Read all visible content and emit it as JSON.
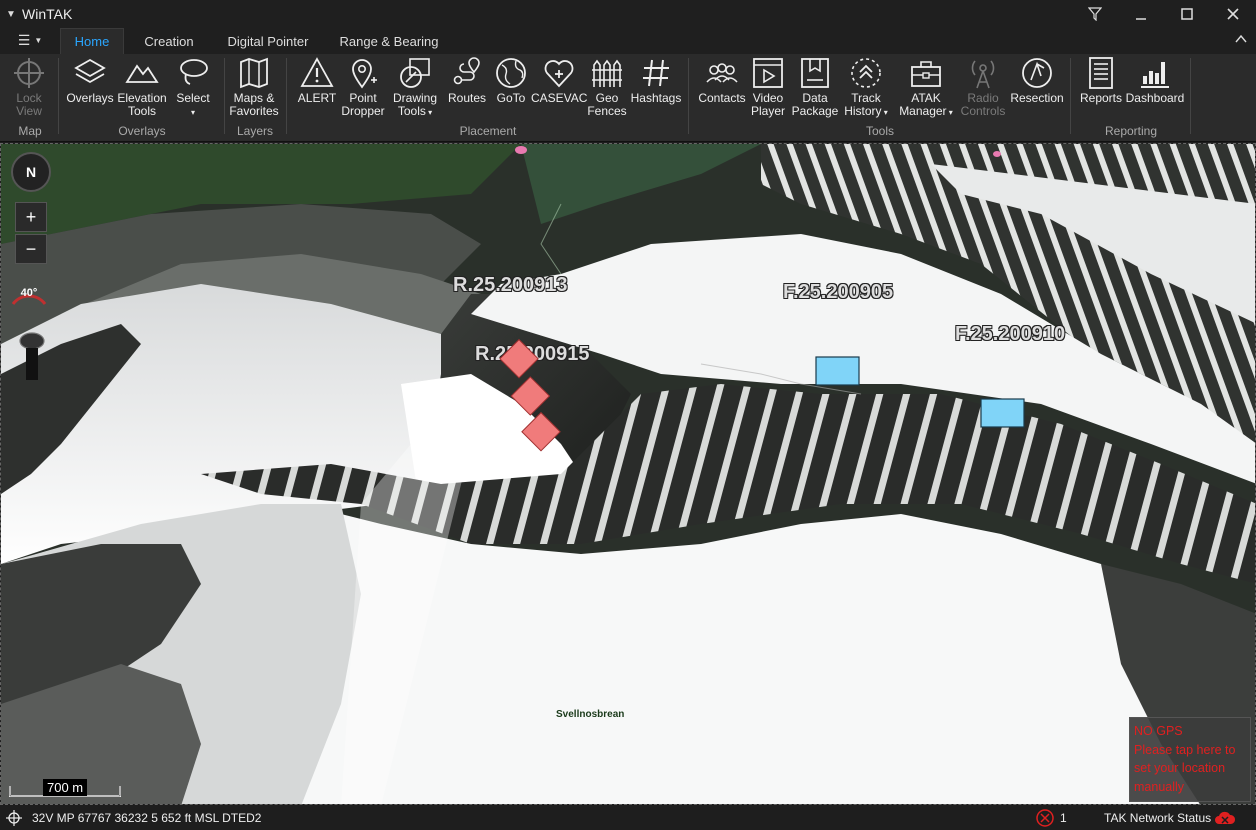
{
  "window": {
    "title": "WinTAK"
  },
  "tabs": [
    {
      "label": "Home"
    },
    {
      "label": "Creation"
    },
    {
      "label": "Digital Pointer"
    },
    {
      "label": "Range & Bearing"
    }
  ],
  "ribbon": {
    "buttons": [
      {
        "label1": "Lock",
        "label2": "View",
        "icon": "crosshair-icon",
        "disabled": true
      },
      {
        "label1": "Overlays",
        "label2": "",
        "icon": "layers-icon"
      },
      {
        "label1": "Elevation",
        "label2": "Tools",
        "icon": "mountain-icon"
      },
      {
        "label1": "Select",
        "label2": "",
        "icon": "lasso-icon",
        "dropdown": true
      },
      {
        "label1": "Maps &",
        "label2": "Favorites",
        "icon": "map-icon"
      },
      {
        "label1": "ALERT",
        "label2": "",
        "icon": "warning-icon"
      },
      {
        "label1": "Point",
        "label2": "Dropper",
        "icon": "pin-icon"
      },
      {
        "label1": "Drawing",
        "label2": "Tools",
        "icon": "drawing-icon",
        "dropdown": true
      },
      {
        "label1": "Routes",
        "label2": "",
        "icon": "routes-icon"
      },
      {
        "label1": "GoTo",
        "label2": "",
        "icon": "globe-icon"
      },
      {
        "label1": "CASEVAC",
        "label2": "",
        "icon": "casevac-icon"
      },
      {
        "label1": "Geo",
        "label2": "Fences",
        "icon": "fence-icon"
      },
      {
        "label1": "Hashtags",
        "label2": "",
        "icon": "hashtag-icon"
      },
      {
        "label1": "Contacts",
        "label2": "",
        "icon": "contacts-icon"
      },
      {
        "label1": "Video",
        "label2": "Player",
        "icon": "video-icon"
      },
      {
        "label1": "Data",
        "label2": "Package",
        "icon": "package-icon"
      },
      {
        "label1": "Track",
        "label2": "History",
        "icon": "track-icon",
        "dropdown": true
      },
      {
        "label1": "ATAK",
        "label2": "Manager",
        "icon": "toolbox-icon",
        "dropdown": true
      },
      {
        "label1": "Radio",
        "label2": "Controls",
        "icon": "radio-icon",
        "disabled": true
      },
      {
        "label1": "Resection",
        "label2": "",
        "icon": "resection-icon"
      },
      {
        "label1": "Reports",
        "label2": "",
        "icon": "reports-icon"
      },
      {
        "label1": "Dashboard",
        "label2": "",
        "icon": "dashboard-icon"
      }
    ],
    "groups": [
      {
        "label": "Map"
      },
      {
        "label": "Overlays"
      },
      {
        "label": "Layers"
      },
      {
        "label": "Placement"
      },
      {
        "label": "Tools"
      },
      {
        "label": "Reporting"
      }
    ]
  },
  "map": {
    "compass_label": "N",
    "zoom_in": "+",
    "zoom_out": "−",
    "tilt": "40°",
    "scale_label": "700 m",
    "markers": [
      {
        "label": "R.25.200913"
      },
      {
        "label": "R.25.200915"
      },
      {
        "label": "F.25.200905"
      },
      {
        "label": "F.25.200910"
      }
    ],
    "place_name": "Svellnosbrean",
    "gps_notice": {
      "line1": "NO GPS",
      "line2": "Please tap here to",
      "line3": "set your location",
      "line4": "manually"
    },
    "colors": {
      "hostile": "#f08080",
      "friendly": "#80d8ff"
    }
  },
  "status": {
    "coords": "32V  MP  67767  36232  5 652 ft MSL DTED2",
    "alert_count": "1",
    "network": "TAK Network Status"
  }
}
